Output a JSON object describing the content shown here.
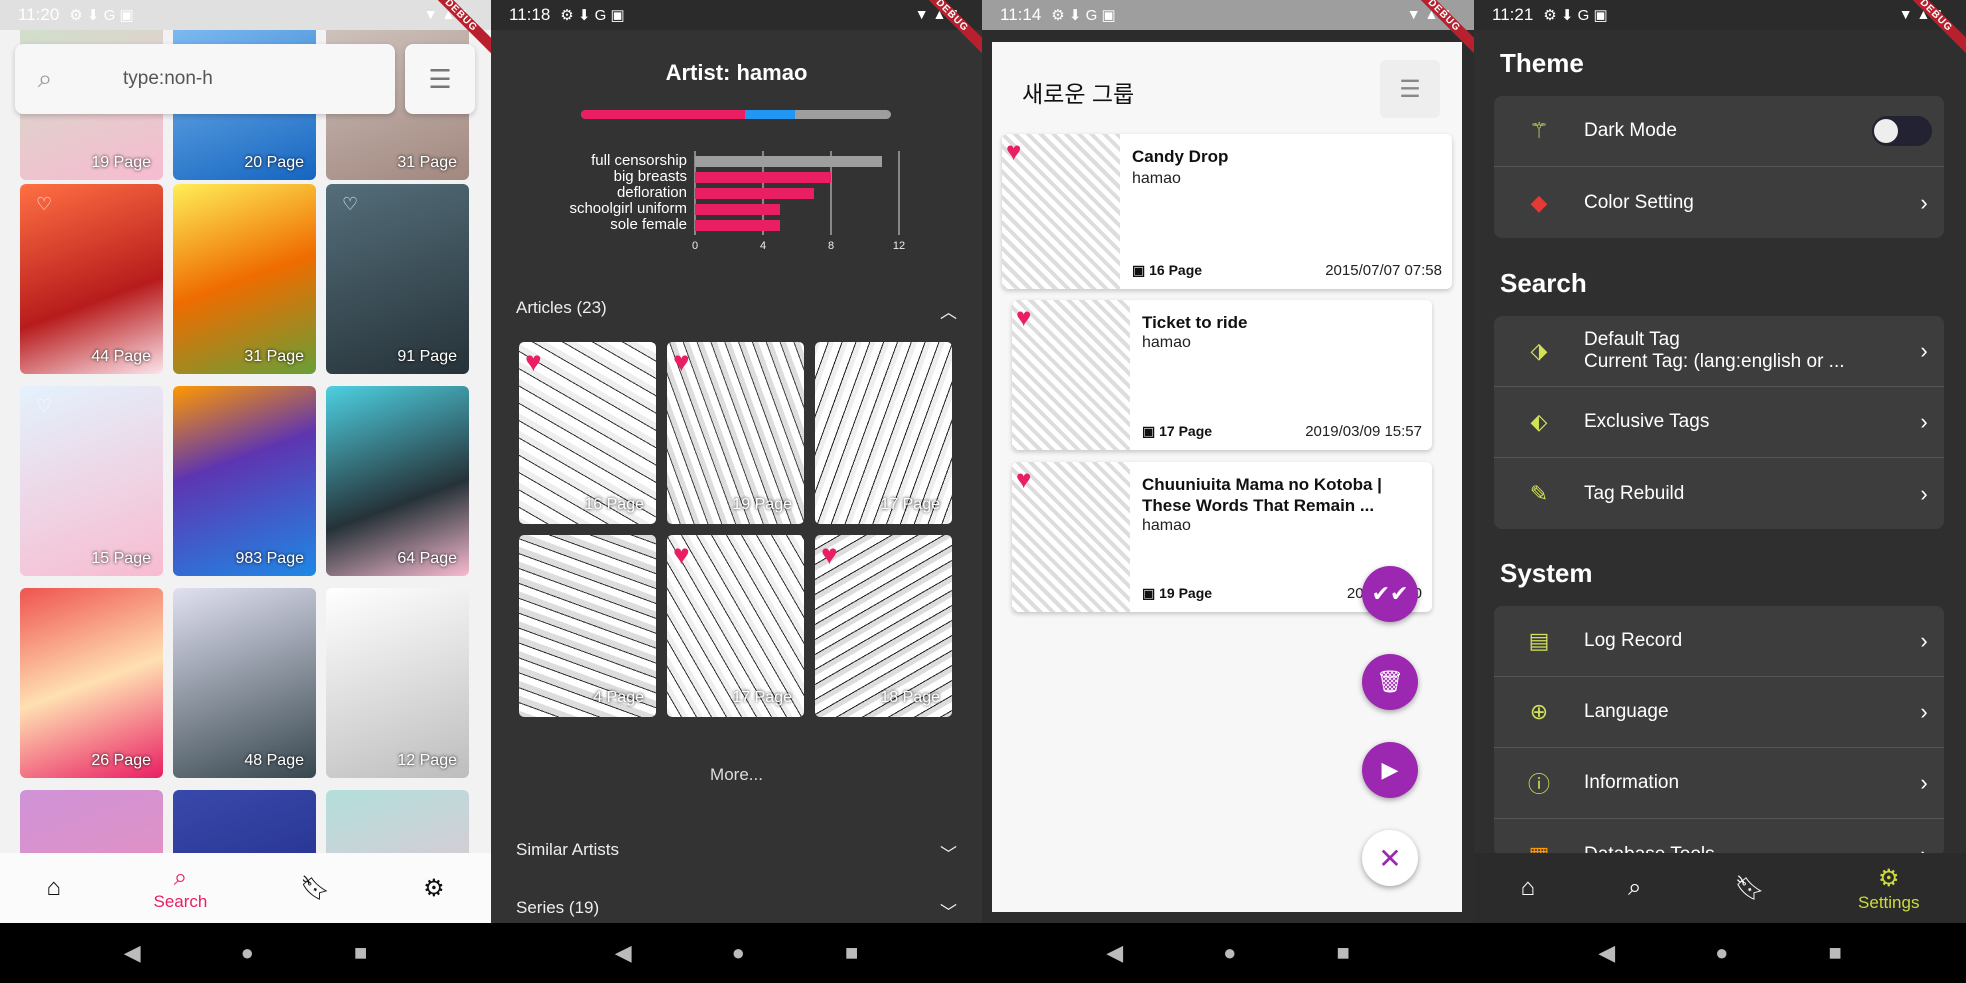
{
  "colors": {
    "pink": "#e91e63",
    "blue": "#2196f3",
    "purple": "#9c27b0",
    "lime": "#cddc39"
  },
  "s1": {
    "time": "11:20",
    "search_value": "type:non-h",
    "thumbs": [
      {
        "pages": "19 Page"
      },
      {
        "pages": "20 Page"
      },
      {
        "pages": "31 Page"
      },
      {
        "pages": "44 Page"
      },
      {
        "pages": "31 Page"
      },
      {
        "pages": "91 Page"
      },
      {
        "pages": "15 Page"
      },
      {
        "pages": "983 Page"
      },
      {
        "pages": "64 Page"
      },
      {
        "pages": "26 Page"
      },
      {
        "pages": "48 Page"
      },
      {
        "pages": "12 Page"
      }
    ],
    "nav": {
      "search_label": "Search"
    }
  },
  "s2": {
    "time": "11:18",
    "title": "Artist: hamao",
    "bar": {
      "pink": 0.53,
      "blue": 0.16,
      "gray": 0.31
    },
    "chart_data": {
      "type": "bar",
      "orientation": "horizontal",
      "categories": [
        "full censorship",
        "big breasts",
        "defloration",
        "schoolgirl uniform",
        "sole female"
      ],
      "values": [
        11,
        8,
        7,
        5,
        5
      ],
      "colors": [
        "#9e9e9e",
        "#e91e63",
        "#e91e63",
        "#e91e63",
        "#e91e63"
      ],
      "xticks": [
        "0",
        "4",
        "8",
        "12"
      ],
      "xlim": [
        0,
        12
      ],
      "grid": true
    },
    "articles_label": "Articles (23)",
    "articles": [
      {
        "pages": "16 Page",
        "liked": true
      },
      {
        "pages": "19 Page",
        "liked": true
      },
      {
        "pages": "17 Page",
        "liked": false
      },
      {
        "pages": "4 Page",
        "liked": false
      },
      {
        "pages": "17 Page",
        "liked": true
      },
      {
        "pages": "18 Page",
        "liked": true
      }
    ],
    "more_label": "More...",
    "similar_label": "Similar Artists",
    "series_label": "Series (19)"
  },
  "s3": {
    "time": "11:14",
    "title": "새로운 그룹",
    "cards": [
      {
        "title": "Candy Drop",
        "artist": "hamao",
        "pages": "16 Page",
        "date": "2015/07/07 07:58"
      },
      {
        "title": "Ticket to ride",
        "artist": "hamao",
        "pages": "17 Page",
        "date": "2019/03/09 15:57"
      },
      {
        "title": "Chuuniuita Mama no Kotoba | These Words That Remain ...",
        "artist": "hamao",
        "pages": "19 Page",
        "date": "2020/03/30"
      }
    ]
  },
  "s4": {
    "time": "11:21",
    "theme_header": "Theme",
    "dark_mode": "Dark Mode",
    "color_setting": "Color Setting",
    "search_header": "Search",
    "default_tag": "Default Tag",
    "current_tag": "Current Tag: (lang:english or ...",
    "exclusive_tags": "Exclusive Tags",
    "tag_rebuild": "Tag Rebuild",
    "system_header": "System",
    "log_record": "Log Record",
    "language": "Language",
    "information": "Information",
    "partial_item": "Database Tools",
    "nav_settings": "Settings"
  }
}
